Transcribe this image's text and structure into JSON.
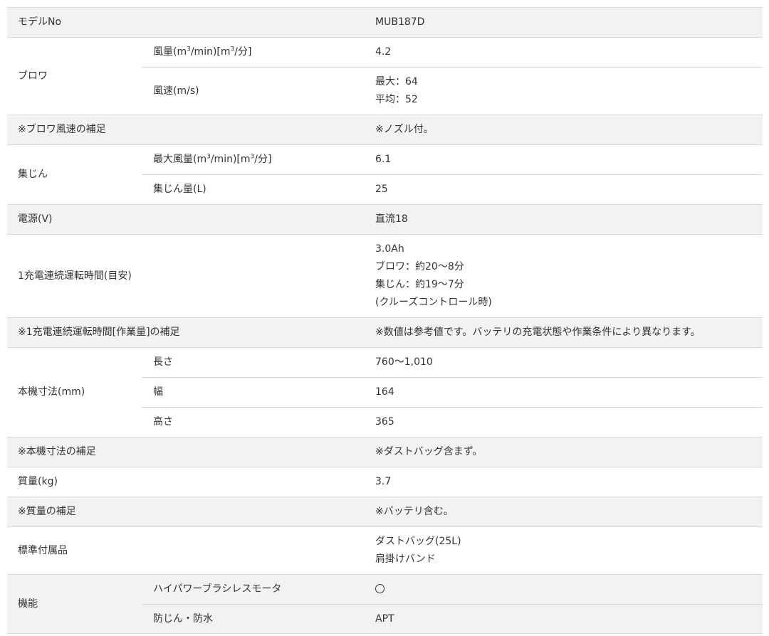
{
  "rows": {
    "model": {
      "label": "モデルNo",
      "value": "MUB187D"
    },
    "blower": {
      "label": "ブロワ",
      "airflow": {
        "label_pre": "風量(m",
        "sup1": "3",
        "label_mid": "/min)[m",
        "sup2": "3",
        "label_post": "/分]",
        "value": "4.2"
      },
      "wind_speed": {
        "label": "風速(m/s)",
        "max": "最大：64",
        "avg": "平均：52"
      }
    },
    "blower_note": {
      "label": "※ブロワ風速の補足",
      "value": "※ノズル付。"
    },
    "dust": {
      "label": "集じん",
      "max_airflow": {
        "label_pre": "最大風量(m",
        "sup1": "3",
        "label_mid": "/min)[m",
        "sup2": "3",
        "label_post": "/分]",
        "value": "6.1"
      },
      "capacity": {
        "label": "集じん量(L)",
        "value": "25"
      }
    },
    "power": {
      "label": "電源(V)",
      "value": "直流18"
    },
    "runtime": {
      "label": "1充電連続運転時間(目安)",
      "lines": [
        "3.0Ah",
        "ブロワ：約20〜8分",
        "集じん：約19〜7分",
        "(クルーズコントロール時)"
      ]
    },
    "runtime_note": {
      "label": "※1充電連続運転時間[作業量]の補足",
      "value": "※数値は参考値です。バッテリの充電状態や作業条件により異なります。"
    },
    "dimensions": {
      "label": "本機寸法(mm)",
      "length": {
        "label": "長さ",
        "value": "760〜1,010"
      },
      "width": {
        "label": "幅",
        "value": "164"
      },
      "height": {
        "label": "高さ",
        "value": "365"
      }
    },
    "dimensions_note": {
      "label": "※本機寸法の補足",
      "value": "※ダストバッグ含まず。"
    },
    "mass": {
      "label": "質量(kg)",
      "value": "3.7"
    },
    "mass_note": {
      "label": "※質量の補足",
      "value": "※バッテリ含む。"
    },
    "accessories": {
      "label": "標準付属品",
      "lines": [
        "ダストバッグ(25L)",
        "肩掛けバンド"
      ]
    },
    "features": {
      "label": "機能",
      "brushless": {
        "label": "ハイパワーブラシレスモータ",
        "value": "yes"
      },
      "dustproof": {
        "label": "防じん・防水",
        "value": "APT"
      }
    }
  }
}
